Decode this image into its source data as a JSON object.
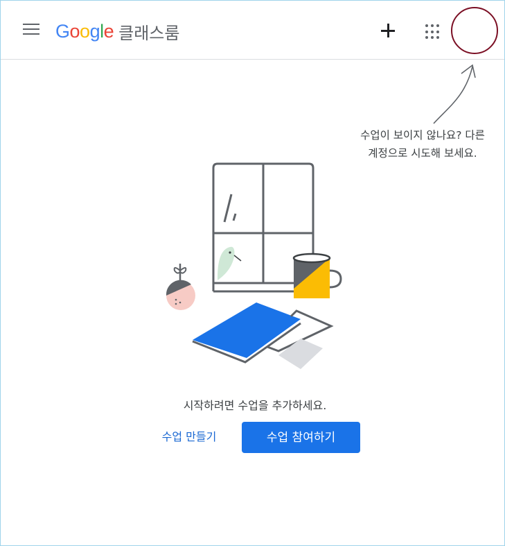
{
  "header": {
    "logo_google_letters": [
      "G",
      "o",
      "o",
      "g",
      "l",
      "e"
    ],
    "logo_colors": [
      "#4285F4",
      "#EA4335",
      "#FBBC05",
      "#4285F4",
      "#34A853",
      "#EA4335"
    ],
    "product_name": "클래스룸",
    "icons": [
      "main-menu-icon",
      "plus-icon",
      "apps-grid-icon",
      "account-avatar"
    ]
  },
  "hint": {
    "line1": "수업이 보이지 않나요? 다른",
    "line2": "계정으로 시도해 보세요."
  },
  "empty_state": {
    "message": "시작하려면 수업을 추가하세요.",
    "create_label": "수업 만들기",
    "join_label": "수업 참여하기"
  },
  "colors": {
    "accent": "#1a73e8",
    "avatar_ring": "#7b0f24",
    "illustration_blue": "#1a73e8",
    "illustration_yellow": "#fbbc04",
    "illustration_pink": "#f7cbc5",
    "illustration_green": "#cfe8d6"
  }
}
